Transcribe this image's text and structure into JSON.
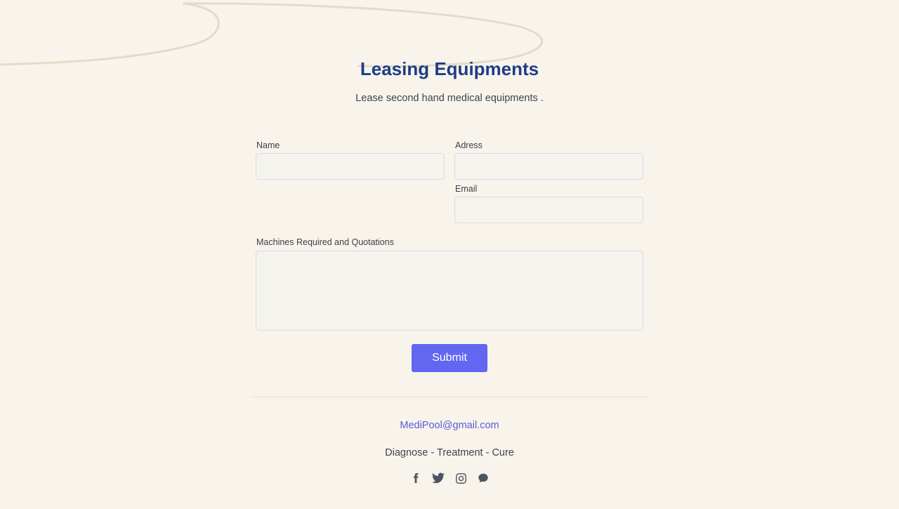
{
  "header": {
    "title": "Leasing Equipments",
    "subtitle": "Lease second hand medical equipments ."
  },
  "form": {
    "name_label": "Name",
    "address_label": "Adress",
    "email_label": "Email",
    "machines_label": "Machines Required and Quotations",
    "name_value": "",
    "address_value": "",
    "email_value": "",
    "machines_value": "",
    "submit_label": "Submit"
  },
  "footer": {
    "email": "MediPool@gmail.com",
    "tagline": "Diagnose - Treatment - Cure",
    "social_icons": [
      "facebook-icon",
      "twitter-icon",
      "instagram-icon",
      "chat-icon"
    ]
  },
  "colors": {
    "background": "#f8f4ec",
    "title": "#1f3c88",
    "accent": "#6366f1",
    "link": "#5b5bd6",
    "icon": "#4b5563"
  }
}
